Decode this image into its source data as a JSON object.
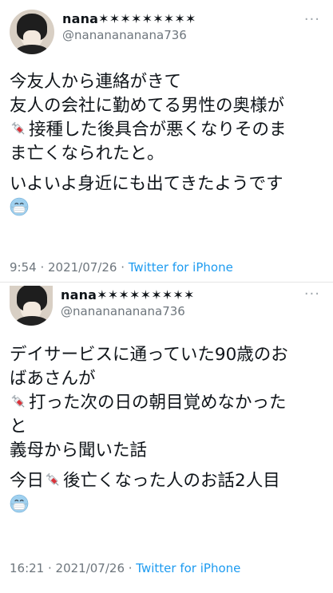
{
  "tweets": [
    {
      "author": {
        "name": "nana✶✶✶✶✶✶✶✶✶",
        "handle": "@nananananana736"
      },
      "more_icon": "ellipsis-icon",
      "paragraphs": [
        [
          "今友人から連絡がきて",
          "友人の会社に勤めてる男性の奥様が",
          "接種した後具合が悪くなりそのま",
          "ま亡くなられたと。"
        ],
        [
          "いよいよ身近にも出てきたようです"
        ]
      ],
      "meta": {
        "time": "9:54 · 2021/07/26 · ",
        "source": "Twitter for iPhone"
      }
    },
    {
      "author": {
        "name": "nana✶✶✶✶✶✶✶✶✶",
        "handle": "@nananananana736"
      },
      "more_icon": "ellipsis-icon",
      "paragraphs": [
        [
          "デイサービスに通っていた90歳のお",
          "ばあさんが",
          "打った次の日の朝目覚めなかった",
          "と",
          "義母から聞いた話"
        ],
        [
          "今日",
          "後亡くなった人のお話2人目"
        ]
      ],
      "meta": {
        "time": "16:21 · 2021/07/26 · ",
        "source": "Twitter for iPhone"
      }
    }
  ],
  "emoji": {
    "syringe": "syringe-emoji",
    "mask": "face-with-medical-mask-emoji"
  },
  "colors": {
    "link": "#1d9bf0",
    "meta": "#6e767d",
    "text": "#0f1419"
  }
}
